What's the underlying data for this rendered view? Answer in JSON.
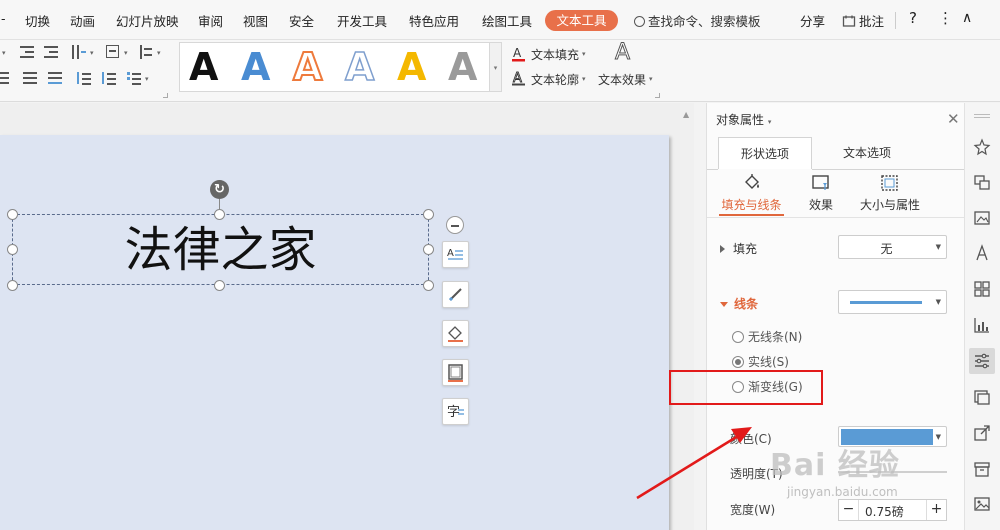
{
  "menu": {
    "items": [
      "切换",
      "动画",
      "幻灯片放映",
      "审阅",
      "视图",
      "安全",
      "开发工具",
      "特色应用",
      "绘图工具"
    ],
    "active_tab": "文本工具",
    "search_text": "查找命令、搜索模板",
    "share": "分享",
    "comment": "批注",
    "help": "?",
    "more": "⋮",
    "collapse": "∧"
  },
  "ribbon": {
    "gallery_letter": "A",
    "text_fill_label": "文本填充",
    "text_outline_label": "文本轮廓",
    "text_effect_label": "文本效果",
    "effect_letter": "A"
  },
  "slide": {
    "text": "法律之家"
  },
  "colors": {
    "accent": "#e8704a",
    "line_color": "#5a9bd5",
    "annotation": "#e21a1a",
    "slide_bg": "#dde4f2"
  },
  "pane": {
    "title": "对象属性",
    "tabs": [
      "形状选项",
      "文本选项"
    ],
    "subtabs": [
      "填充与线条",
      "效果",
      "大小与属性"
    ],
    "fill": {
      "label": "填充",
      "value": "无"
    },
    "line": {
      "label": "线条",
      "options": [
        "无线条(N)",
        "实线(S)",
        "渐变线(G)"
      ],
      "selected": "实线(S)"
    },
    "color_label": "颜色(C)",
    "transparency_label": "透明度(T)",
    "width": {
      "label": "宽度(W)",
      "value": "0.75磅"
    }
  },
  "watermark": {
    "logo": "Bai 经验",
    "url": "jingyan.baidu.com"
  }
}
